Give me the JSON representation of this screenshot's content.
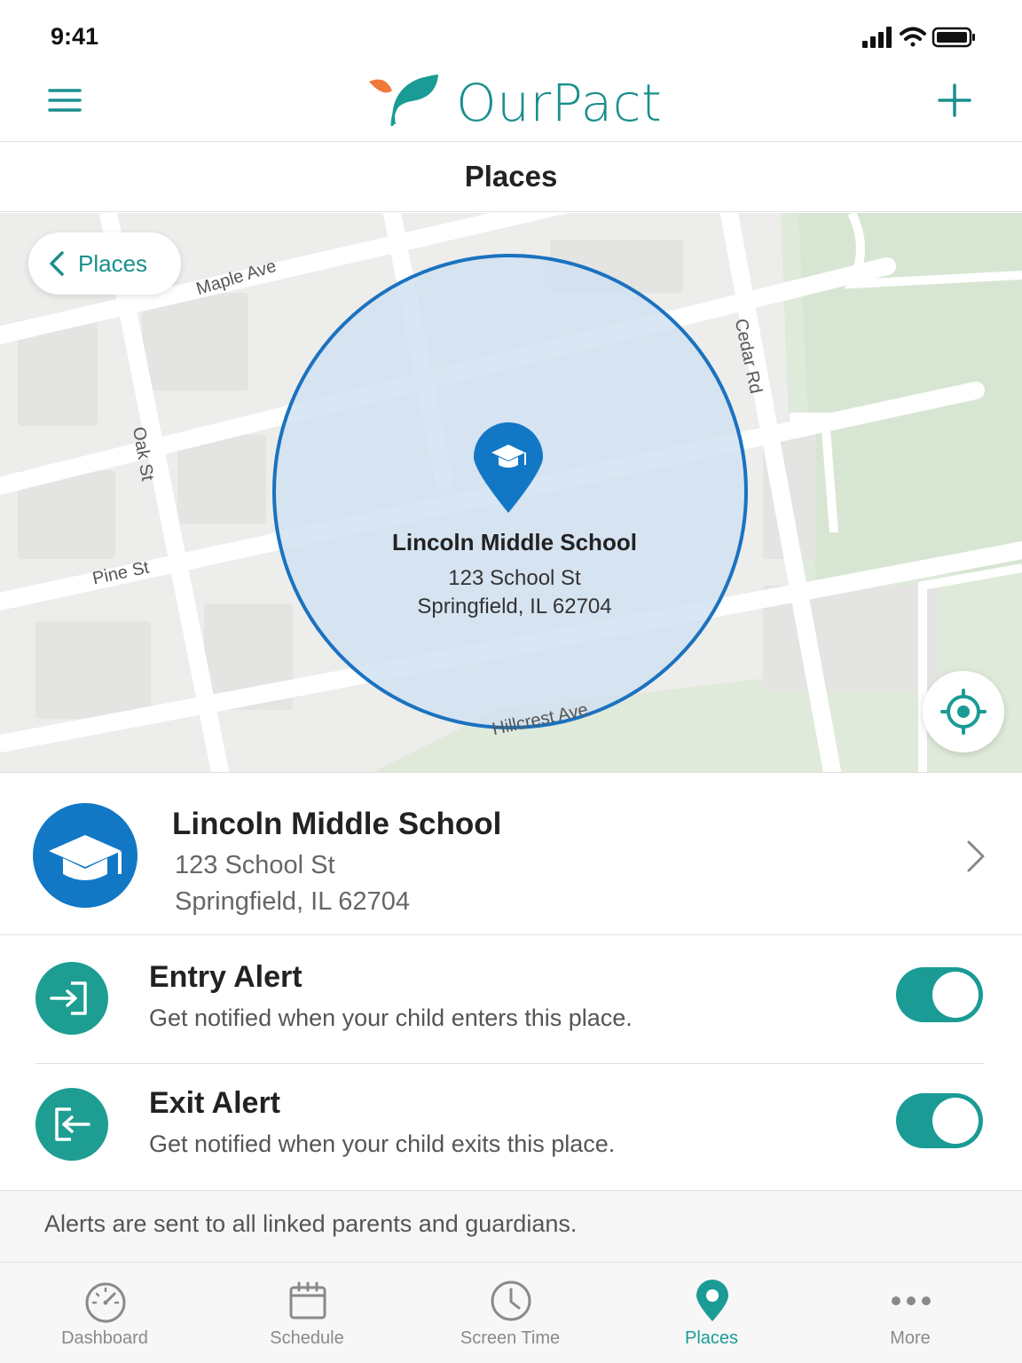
{
  "status_bar": {
    "time": "9:41"
  },
  "app_bar": {
    "brand": "OurPact"
  },
  "page": {
    "title": "Places"
  },
  "map": {
    "back_label": "Places",
    "streets": {
      "maple": "Maple Ave",
      "oak": "Oak St",
      "pine": "Pine St",
      "cedar": "Cedar Rd",
      "hillcrest": "Hillcrest Ave"
    },
    "geofence": {
      "name": "Lincoln Middle School",
      "address_line1": "123 School St",
      "address_line2": "Springfield, IL 62704"
    }
  },
  "place": {
    "name": "Lincoln Middle School",
    "address_line1": "123 School St",
    "address_line2": "Springfield, IL 62704"
  },
  "alerts": [
    {
      "title": "Entry Alert",
      "description": "Get notified when your child enters this place.",
      "enabled": true
    },
    {
      "title": "Exit Alert",
      "description": "Get notified when your child exits this place.",
      "enabled": true
    }
  ],
  "footnote": "Alerts are sent to all linked parents and guardians.",
  "tabs": [
    {
      "label": "Dashboard",
      "icon": "gauge-icon",
      "active": false
    },
    {
      "label": "Schedule",
      "icon": "calendar-icon",
      "active": false
    },
    {
      "label": "Screen Time",
      "icon": "clock-icon",
      "active": false
    },
    {
      "label": "Places",
      "icon": "location-pin-icon",
      "active": true
    },
    {
      "label": "More",
      "icon": "more-dots-icon",
      "active": false
    }
  ],
  "colors": {
    "brand_teal": "#1a8f8d",
    "toggle_on": "#1a9b95",
    "place_blue": "#1278c6",
    "geofence_stroke": "#1a72c0",
    "leaf_orange": "#f07a3a"
  }
}
